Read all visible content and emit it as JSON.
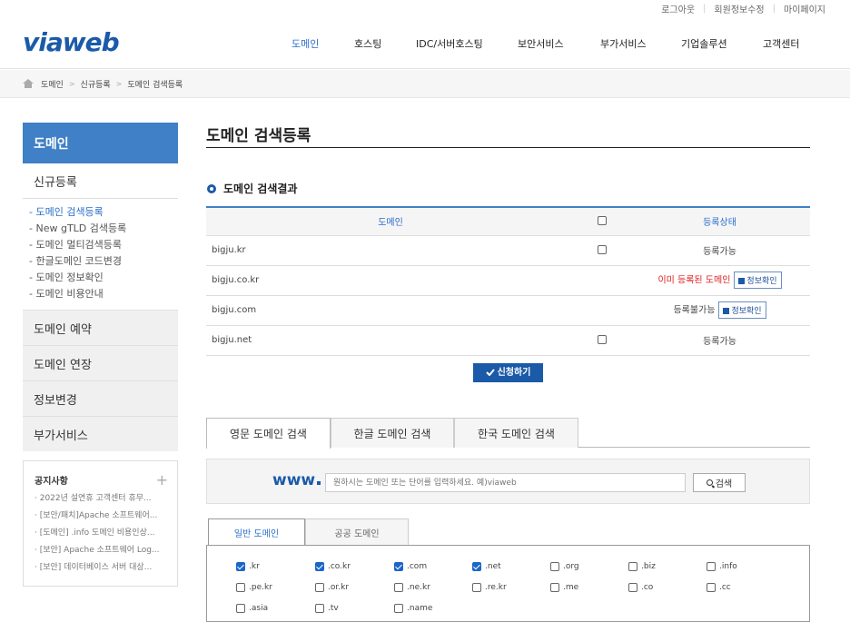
{
  "top_links": [
    "로그아웃",
    "회원정보수정",
    "마이페이지"
  ],
  "logo": "viaweb",
  "gnb": [
    "도메인",
    "호스팅",
    "IDC/서버호스팅",
    "보안서비스",
    "부가서비스",
    "기업솔루션",
    "고객센터"
  ],
  "breadcrumb": [
    "도메인",
    "신규등록",
    "도메인 검색등록"
  ],
  "sidebar": {
    "title": "도메인",
    "head": "신규등록",
    "sub": [
      "- 도메인 검색등록",
      "- New gTLD 검색등록",
      "- 도메인 멀티검색등록",
      "- 한글도메인 코드변경",
      "- 도메인 정보확인",
      "- 도메인 비용안내"
    ],
    "menus": [
      "도메인 예약",
      "도메인 연장",
      "정보변경",
      "부가서비스"
    ]
  },
  "notice": {
    "title": "공지사항",
    "plus": "+",
    "items": [
      "· 2022년 설연휴 고객센터 휴무...",
      "· [보안/패치]Apache 소프트웨어...",
      "· [도메인] .info 도메인 비용인상...",
      "· [보안] Apache 소프트웨어 Log...",
      "· [보안] 데이터베이스 서버 대상..."
    ]
  },
  "page_title": "도메인 검색등록",
  "result_title": "도메인 검색결과",
  "table": {
    "col_domain": "도메인",
    "col_status": "등록상태",
    "info_label": "정보확인",
    "rows": [
      {
        "domain": "bigju.kr",
        "status": "등록가능",
        "checkbox": true,
        "info": false,
        "taken": false
      },
      {
        "domain": "bigju.co.kr",
        "status": "이미 등록된 도메인",
        "checkbox": false,
        "info": true,
        "taken": true
      },
      {
        "domain": "bigju.com",
        "status": "등록불가능",
        "checkbox": false,
        "info": true,
        "taken": false
      },
      {
        "domain": "bigju.net",
        "status": "등록가능",
        "checkbox": true,
        "info": false,
        "taken": false
      }
    ]
  },
  "apply_label": "신청하기",
  "search_tabs": [
    "영문 도메인 검색",
    "한글 도메인 검색",
    "한국 도메인 검색"
  ],
  "search": {
    "www": "www",
    "placeholder": "원하시는 도메인 또는 단어를 입력하세요. 예)viaweb",
    "button": "검색"
  },
  "sub_tabs": [
    "일반 도메인",
    "공공 도메인"
  ],
  "tlds": [
    {
      "label": ".kr",
      "checked": true
    },
    {
      "label": ".co.kr",
      "checked": true
    },
    {
      "label": ".com",
      "checked": true
    },
    {
      "label": ".net",
      "checked": true
    },
    {
      "label": ".org",
      "checked": false
    },
    {
      "label": ".biz",
      "checked": false
    },
    {
      "label": ".info",
      "checked": false
    },
    {
      "label": ".pe.kr",
      "checked": false
    },
    {
      "label": ".or.kr",
      "checked": false
    },
    {
      "label": ".ne.kr",
      "checked": false
    },
    {
      "label": ".re.kr",
      "checked": false
    },
    {
      "label": ".me",
      "checked": false
    },
    {
      "label": ".co",
      "checked": false
    },
    {
      "label": ".cc",
      "checked": false
    },
    {
      "label": ".asia",
      "checked": false
    },
    {
      "label": ".tv",
      "checked": false
    },
    {
      "label": ".name",
      "checked": false
    }
  ],
  "colors": {
    "brand": "#1b5aa8",
    "accent": "#3f80c6",
    "taken": "#e02020"
  }
}
